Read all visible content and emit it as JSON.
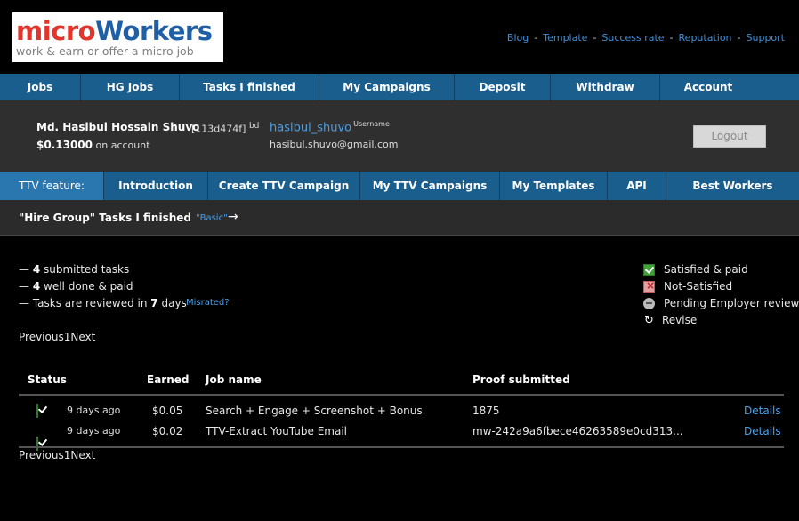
{
  "logo": {
    "part1": "micro",
    "part2": "Workers",
    "tagline": "work & earn or offer a micro job"
  },
  "toplinks": [
    "Blog",
    "Template",
    "Success rate",
    "Reputation",
    "Support"
  ],
  "mainnav": [
    "Jobs",
    "HG Jobs",
    "Tasks I finished",
    "My Campaigns",
    "Deposit",
    "Withdraw",
    "Account"
  ],
  "account": {
    "name": "Md. Hasibul Hossain Shuvo",
    "id": "[113d474f]",
    "country": "bd",
    "balance": "$0.13000",
    "balance_suffix": "on account",
    "username": "hasibul_shuvo",
    "username_label": "Username",
    "email": "hasibul.shuvo@gmail.com",
    "logout": "Logout"
  },
  "ttvnav": [
    "TTV feature:",
    "Introduction",
    "Create TTV Campaign",
    "My TTV Campaigns",
    "My Templates",
    "API",
    "Best Workers"
  ],
  "subtitle": {
    "title": "\"Hire Group\" Tasks I finished",
    "basic": "\"Basic\"",
    "arrow": "→"
  },
  "stats": {
    "submitted_num": "4",
    "submitted_text": "submitted tasks",
    "done_num": "4",
    "done_text": "well done & paid",
    "reviewed_pre": "Tasks are reviewed in",
    "reviewed_num": "7",
    "reviewed_post": "days",
    "misrated": "Misrated?",
    "dash": "—"
  },
  "legend": [
    {
      "icon": "check-icon",
      "label": "Satisfied & paid"
    },
    {
      "icon": "cross-icon",
      "label": "Not-Satisfied"
    },
    {
      "icon": "pending-icon",
      "label": "Pending Employer review"
    },
    {
      "icon": "revise-icon",
      "label": "Revise"
    }
  ],
  "pager": {
    "prev": "Previous",
    "page": "1",
    "next": "Next"
  },
  "table": {
    "headers": [
      "Status",
      "Earned",
      "Job name",
      "Proof submitted"
    ],
    "rows": [
      {
        "status": "check-icon",
        "time": "9 days ago",
        "earned": "$0.05",
        "job": "Search + Engage + Screenshot + Bonus",
        "proof": "1875",
        "details": "Details"
      },
      {
        "status": "check-icon",
        "time": "9 days ago",
        "earned": "$0.02",
        "job": "TTV-Extract YouTube Email",
        "proof": "mw-242a9a6fbece46263589e0cd313...",
        "details": "Details"
      }
    ]
  },
  "colors": {
    "nav": "#1a5e8e",
    "link": "#4aa0e8",
    "panel": "#2f2f2f",
    "ok": "#3fa33a"
  }
}
